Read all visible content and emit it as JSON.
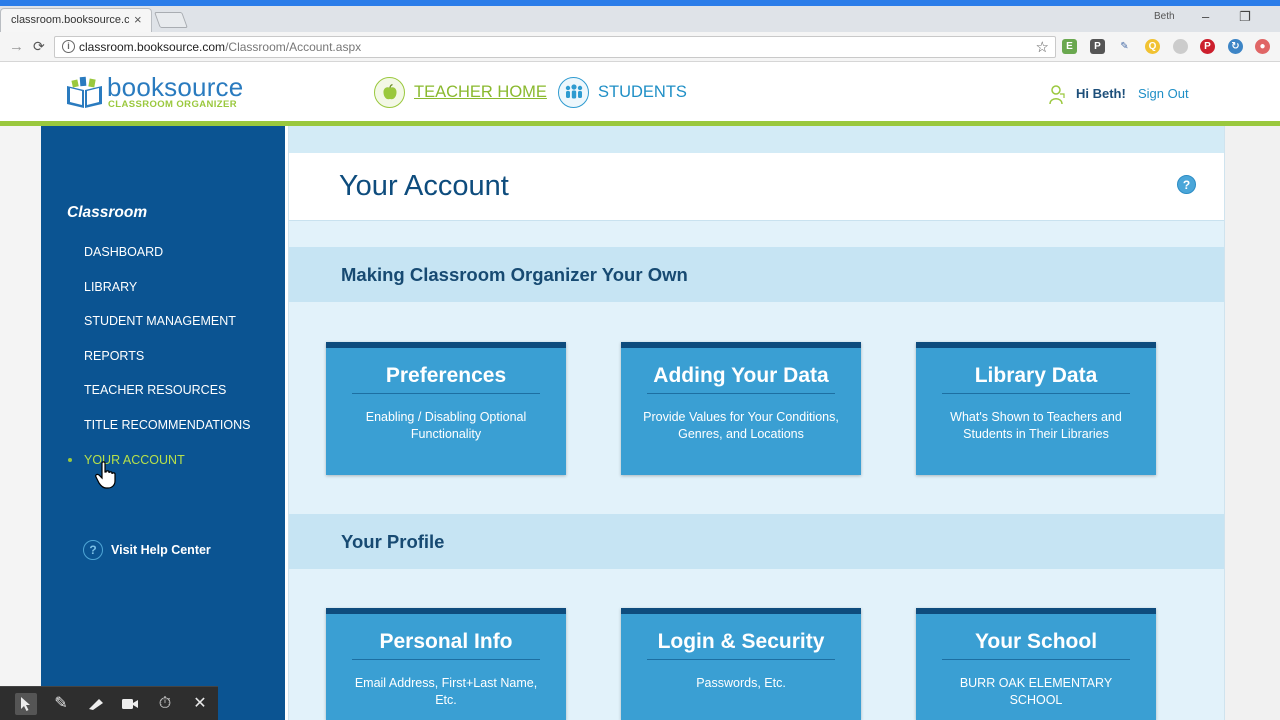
{
  "browser": {
    "tab_title": "classroom.booksource.co",
    "tab_close": "×",
    "user_label": "Beth",
    "window_controls": [
      "–",
      "❐",
      "✕"
    ],
    "back": "→",
    "reload": "⟳",
    "url_host": "classroom.booksource.com",
    "url_path": "/Classroom/Account.aspx",
    "star": "☆",
    "extension_icons": [
      "evernote-icon",
      "pocket-icon",
      "eyedropper-icon",
      "extension-icon",
      "circle-icon",
      "pinterest-icon",
      "sync-icon",
      "adblock-icon",
      "menu-icon"
    ]
  },
  "header": {
    "logo_word": "booksource",
    "logo_sub": "CLASSROOM ORGANIZER",
    "nav_home": "TEACHER HOME",
    "nav_students": "STUDENTS",
    "greeting": "Hi Beth!",
    "sign_out": "Sign Out",
    "colors": {
      "brand_blue": "#2a7bbf",
      "brand_green": "#9ac83d"
    }
  },
  "sidebar": {
    "heading": "Classroom",
    "items": [
      {
        "label": "DASHBOARD"
      },
      {
        "label": "LIBRARY"
      },
      {
        "label": "STUDENT MANAGEMENT"
      },
      {
        "label": "REPORTS"
      },
      {
        "label": "TEACHER RESOURCES"
      },
      {
        "label": "TITLE RECOMMENDATIONS"
      },
      {
        "label": "YOUR ACCOUNT"
      }
    ],
    "active_item": "YOUR ACCOUNT",
    "help_icon": "?",
    "help_label": "Visit Help Center"
  },
  "main": {
    "title": "Your Account",
    "help_badge": "?",
    "sections": [
      {
        "title": "Making Classroom Organizer Your Own",
        "cards": [
          {
            "title": "Preferences",
            "desc": "Enabling / Disabling Optional Functionality"
          },
          {
            "title": "Adding Your Data",
            "desc": "Provide Values for Your Conditions, Genres, and Locations"
          },
          {
            "title": "Library Data",
            "desc": "What's Shown to Teachers and Students in Their Libraries"
          }
        ]
      },
      {
        "title": "Your Profile",
        "cards": [
          {
            "title": "Personal Info",
            "desc": "Email Address, First+Last Name, Etc."
          },
          {
            "title": "Login & Security",
            "desc": "Passwords, Etc."
          },
          {
            "title": "Your School",
            "desc": "BURR OAK ELEMENTARY SCHOOL"
          }
        ]
      }
    ]
  },
  "recorder": {
    "tools": [
      "pointer-icon",
      "pen-icon",
      "highlighter-icon",
      "camera-icon",
      "timer-icon",
      "close-icon"
    ]
  }
}
